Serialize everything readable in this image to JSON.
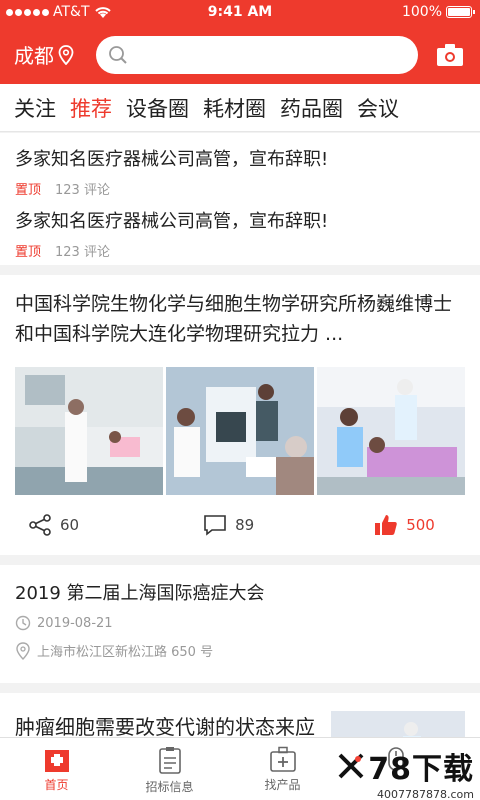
{
  "status": {
    "carrier": "AT&T",
    "time": "9:41 AM",
    "battery": "100%"
  },
  "header": {
    "city": "成都",
    "search_placeholder": ""
  },
  "tabs": [
    {
      "label": "关注"
    },
    {
      "label": "推荐",
      "active": true
    },
    {
      "label": "设备圈"
    },
    {
      "label": "耗材圈"
    },
    {
      "label": "药品圈"
    },
    {
      "label": "会议"
    }
  ],
  "news": [
    {
      "title": "多家知名医疗器械公司高管，宣布辞职!",
      "tag": "置顶",
      "comments": "123 评论"
    },
    {
      "title": "多家知名医疗器械公司高管，宣布辞职!",
      "tag": "置顶",
      "comments": "123 评论"
    }
  ],
  "article": {
    "title": "中国科学院生物化学与细胞生物学研究所杨巍维博士和中国科学院大连化学物理研究拉力 ...",
    "shares": "60",
    "comments": "89",
    "likes": "500"
  },
  "event": {
    "title": "2019 第二届上海国际癌症大会",
    "date": "2019-08-21",
    "location": "上海市松江区新松江路 650 号"
  },
  "article2": {
    "title": "肿瘤细胞需要改变代谢的状态来应答癌基因信号通路传"
  },
  "bottom_nav": [
    {
      "label": "首页",
      "active": true
    },
    {
      "label": "招标信息"
    },
    {
      "label": "找产品"
    }
  ],
  "watermark": {
    "main": "78下载",
    "sub": "4007787878.com"
  },
  "colors": {
    "accent": "#ee3a2d",
    "text": "#222222",
    "meta": "#999999"
  }
}
